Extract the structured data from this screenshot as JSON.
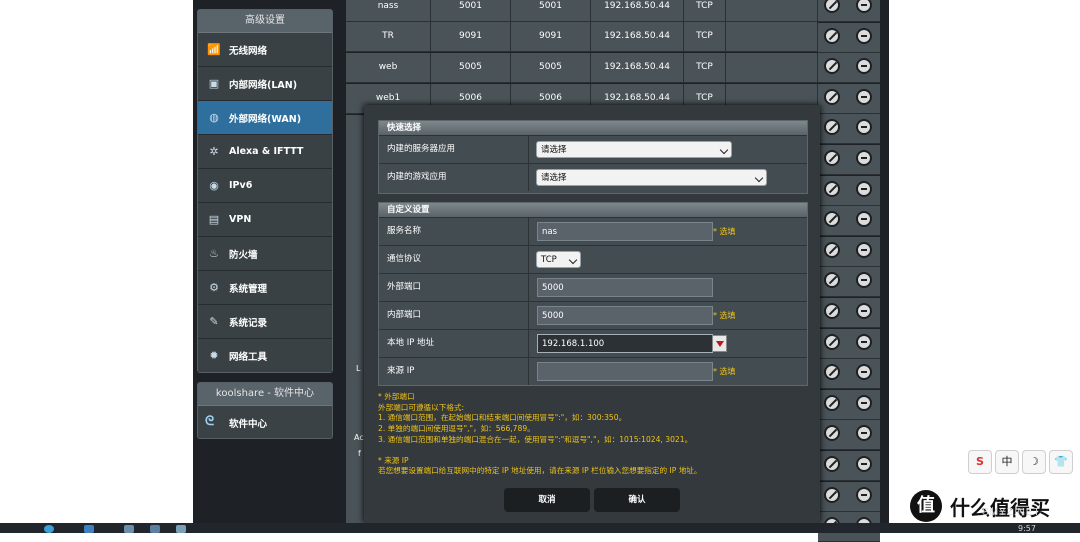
{
  "sidebar": {
    "advanced_header": "高级设置",
    "items": [
      {
        "label": "无线网络",
        "icon": "wifi-icon"
      },
      {
        "label": "内部网络(LAN)",
        "icon": "lan-icon"
      },
      {
        "label": "外部网络(WAN)",
        "icon": "globe-icon",
        "active": true
      },
      {
        "label": "Alexa & IFTTT",
        "icon": "alexa-icon"
      },
      {
        "label": "IPv6",
        "icon": "ipv6-icon"
      },
      {
        "label": "VPN",
        "icon": "vpn-icon"
      },
      {
        "label": "防火墙",
        "icon": "firewall-icon"
      },
      {
        "label": "系统管理",
        "icon": "admin-icon"
      },
      {
        "label": "系统记录",
        "icon": "log-icon"
      },
      {
        "label": "网络工具",
        "icon": "tools-icon"
      }
    ],
    "koolshare_header": "koolshare - 软件中心",
    "software_center": "软件中心"
  },
  "port_table": {
    "rows": [
      {
        "name": "nass",
        "ext_port": "5001",
        "int_port": "5001",
        "ip": "192.168.50.44",
        "protocol": "TCP"
      },
      {
        "name": "TR",
        "ext_port": "9091",
        "int_port": "9091",
        "ip": "192.168.50.44",
        "protocol": "TCP"
      },
      {
        "name": "web",
        "ext_port": "5005",
        "int_port": "5005",
        "ip": "192.168.50.44",
        "protocol": "TCP"
      },
      {
        "name": "web1",
        "ext_port": "5006",
        "int_port": "5006",
        "ip": "192.168.50.44",
        "protocol": "TCP"
      }
    ],
    "left_fragments": [
      "L",
      "Ac",
      "f"
    ]
  },
  "modal": {
    "quick_select": {
      "header": "快速选择",
      "server_app_label": "内建的服务器应用",
      "server_app_value": "请选择",
      "game_app_label": "内建的游戏应用",
      "game_app_value": "请选择"
    },
    "custom": {
      "header": "自定义设置",
      "service_name_label": "服务名称",
      "service_name_value": "nas",
      "protocol_label": "通信协议",
      "protocol_value": "TCP",
      "ext_port_label": "外部端口",
      "ext_port_value": "5000",
      "int_port_label": "内部端口",
      "int_port_value": "5000",
      "local_ip_label": "本地 IP 地址",
      "local_ip_value": "192.168.1.100",
      "source_ip_label": "来源 IP",
      "source_ip_value": "",
      "optional_hint": "* 选填"
    },
    "notes": {
      "ext_title": "* 外部端口",
      "ext_desc": "外部端口可遵循以下格式:",
      "ext_1": "1. 通信端口范围，在起始端口和结束端口间使用冒号\":\"，如：300:350。",
      "ext_2": "2. 单独的端口间使用逗号\",\"，如：566,789。",
      "ext_3": "3. 通信端口范围和单独的端口混合在一起，使用冒号\":\"和逗号\",\"，如：1015:1024, 3021。",
      "src_title": "* 来源 IP",
      "src_desc": "若您想要设置端口给互联网中的特定 IP 地址使用，请在来源 IP 栏位输入您想要指定的 IP 地址。"
    },
    "cancel_label": "取消",
    "ok_label": "确认"
  },
  "tray": {
    "items": [
      "S",
      "中",
      "☽",
      "👕"
    ]
  },
  "brand": {
    "logo_char": "值",
    "text": "什么值得买",
    "url": "SMYZ.NET"
  },
  "taskbar": {
    "time": "9:57"
  }
}
